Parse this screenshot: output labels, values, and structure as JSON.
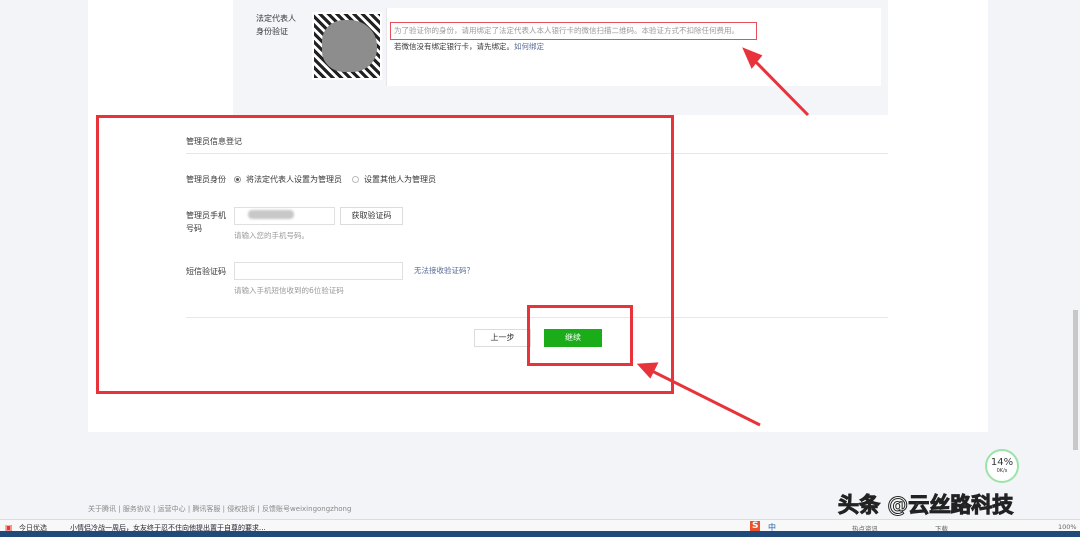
{
  "verify": {
    "label": "法定代表人身份验证",
    "note": "为了验证你的身份，请用绑定了法定代表人本人银行卡的微信扫描二维码。本验证方式不扣除任何费用。",
    "tip": "若微信没有绑定银行卡，请先绑定。",
    "tip_link": "如何绑定"
  },
  "admin": {
    "section_title": "管理员信息登记",
    "identity_label": "管理员身份",
    "option1": "将法定代表人设置为管理员",
    "option2": "设置其他人为管理员",
    "phone_label": "管理员手机号码",
    "get_code": "获取验证码",
    "phone_hint": "请输入您的手机号码。",
    "sms_label": "短信验证码",
    "sms_link": "无法接收验证码？",
    "sms_hint": "请输入手机短信收到的6位验证码",
    "prev": "上一步",
    "next": "继续"
  },
  "footer": [
    "关于腾讯",
    "服务协议",
    "运营中心",
    "腾讯客服",
    "侵权投诉",
    "反馈账号weixingongzhong"
  ],
  "speed": {
    "percent": "14%",
    "rate": "0K/s"
  },
  "watermark": "头条 @云丝路科技",
  "taskbar": {
    "left": "今日优选",
    "news": "小情侣冷战一周后，女友终于忍不住向他提出置于自尊的要求...",
    "hot": "热点资讯",
    "download": "下载",
    "zoom": "100%",
    "ime": "中"
  },
  "colors": {
    "accent": "#1aad19",
    "annotation": "#e9333b",
    "link": "#576b95"
  }
}
